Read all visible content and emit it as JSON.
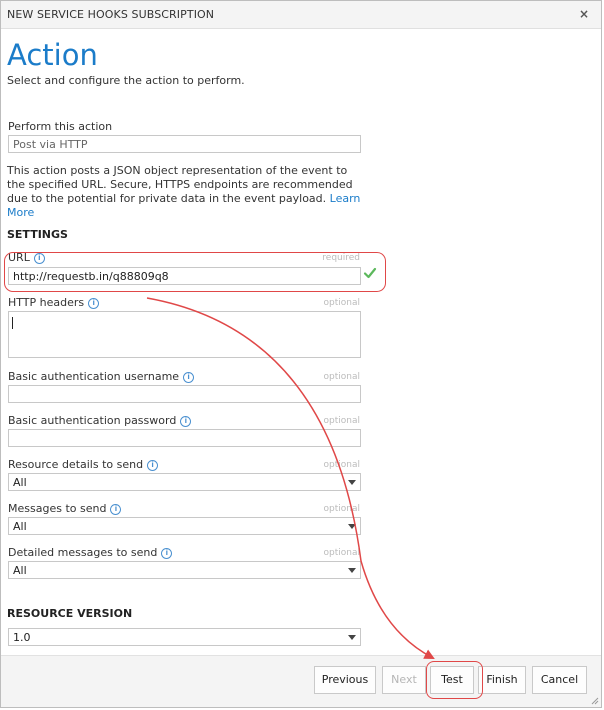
{
  "dialog": {
    "title": "NEW SERVICE HOOKS SUBSCRIPTION",
    "close_glyph": "×"
  },
  "header": {
    "title": "Action",
    "subtitle": "Select and configure the action to perform."
  },
  "action": {
    "label": "Perform this action",
    "value": "Post via HTTP",
    "description": "This action posts a JSON object representation of the event to the specified URL. Secure, HTTPS endpoints are recommended due to the potential for private data in the event payload.",
    "learn_more": "Learn More"
  },
  "settings": {
    "heading": "SETTINGS",
    "url": {
      "label": "URL",
      "hint": "required",
      "value": "http://requestb.in/q88809q8"
    },
    "http_headers": {
      "label": "HTTP headers",
      "hint": "optional"
    },
    "basic_user": {
      "label": "Basic authentication username",
      "hint": "optional"
    },
    "basic_pass": {
      "label": "Basic authentication password",
      "hint": "optional"
    },
    "resource_details": {
      "label": "Resource details to send",
      "hint": "optional",
      "value": "All"
    },
    "messages": {
      "label": "Messages to send",
      "hint": "optional",
      "value": "All"
    },
    "detailed_messages": {
      "label": "Detailed messages to send",
      "hint": "optional",
      "value": "All"
    }
  },
  "resource_version": {
    "heading": "RESOURCE VERSION",
    "value": "1.0"
  },
  "info_glyph": "i",
  "footer": {
    "previous": "Previous",
    "next": "Next",
    "test": "Test",
    "finish": "Finish",
    "cancel": "Cancel"
  },
  "colors": {
    "accent": "#1b7cc9",
    "annotation": "#e04848",
    "check": "#5cb85c"
  }
}
